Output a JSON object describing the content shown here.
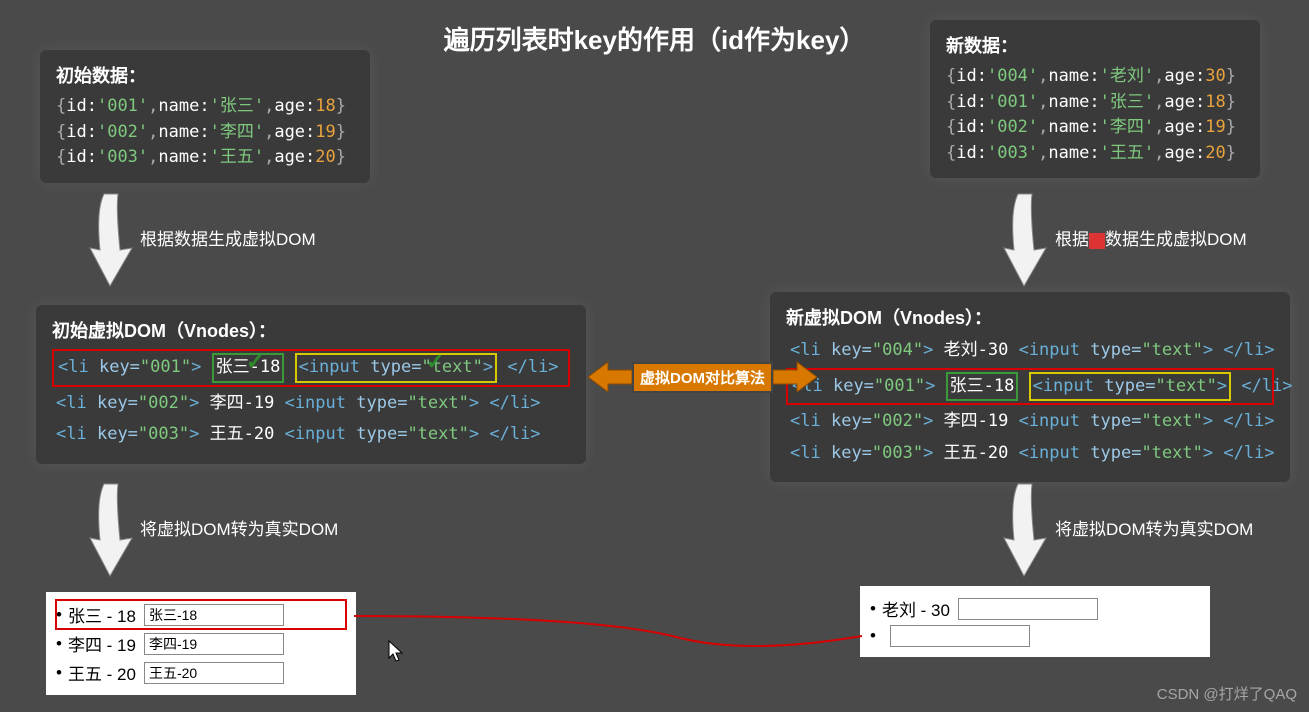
{
  "title": "遍历列表时key的作用（id作为key）",
  "left": {
    "data_title": "初始数据：",
    "records": [
      {
        "id": "001",
        "name": "张三",
        "age": 18
      },
      {
        "id": "002",
        "name": "李四",
        "age": 19
      },
      {
        "id": "003",
        "name": "王五",
        "age": 20
      }
    ],
    "step1": "根据数据生成虚拟DOM",
    "vdom_title": "初始虚拟DOM（Vnodes）：",
    "vdom": [
      {
        "key": "001",
        "text": "张三-18"
      },
      {
        "key": "002",
        "text": "李四-19"
      },
      {
        "key": "003",
        "text": "王五-20"
      }
    ],
    "step2": "将虚拟DOM转为真实DOM",
    "real": [
      {
        "label": "张三 - 18",
        "input": "张三-18"
      },
      {
        "label": "李四 - 19",
        "input": "李四-19"
      },
      {
        "label": "王五 - 20",
        "input": "王五-20"
      }
    ]
  },
  "right": {
    "data_title": "新数据：",
    "records": [
      {
        "id": "004",
        "name": "老刘",
        "age": 30
      },
      {
        "id": "001",
        "name": "张三",
        "age": 18
      },
      {
        "id": "002",
        "name": "李四",
        "age": 19
      },
      {
        "id": "003",
        "name": "王五",
        "age": 20
      }
    ],
    "step1_pre": "根据",
    "step1_post": "数据生成虚拟DOM",
    "vdom_title": "新虚拟DOM（Vnodes）：",
    "vdom": [
      {
        "key": "004",
        "text": "老刘-30"
      },
      {
        "key": "001",
        "text": "张三-18"
      },
      {
        "key": "002",
        "text": "李四-19"
      },
      {
        "key": "003",
        "text": "王五-20"
      }
    ],
    "step2": "将虚拟DOM转为真实DOM",
    "real": [
      {
        "label": "老刘 - 30",
        "input": ""
      },
      {
        "label": "",
        "input": ""
      }
    ]
  },
  "diff_label": "虚拟DOM对比算法",
  "input_tag": "<input type=\"text\">",
  "watermark": "CSDN @打烊了QAQ"
}
